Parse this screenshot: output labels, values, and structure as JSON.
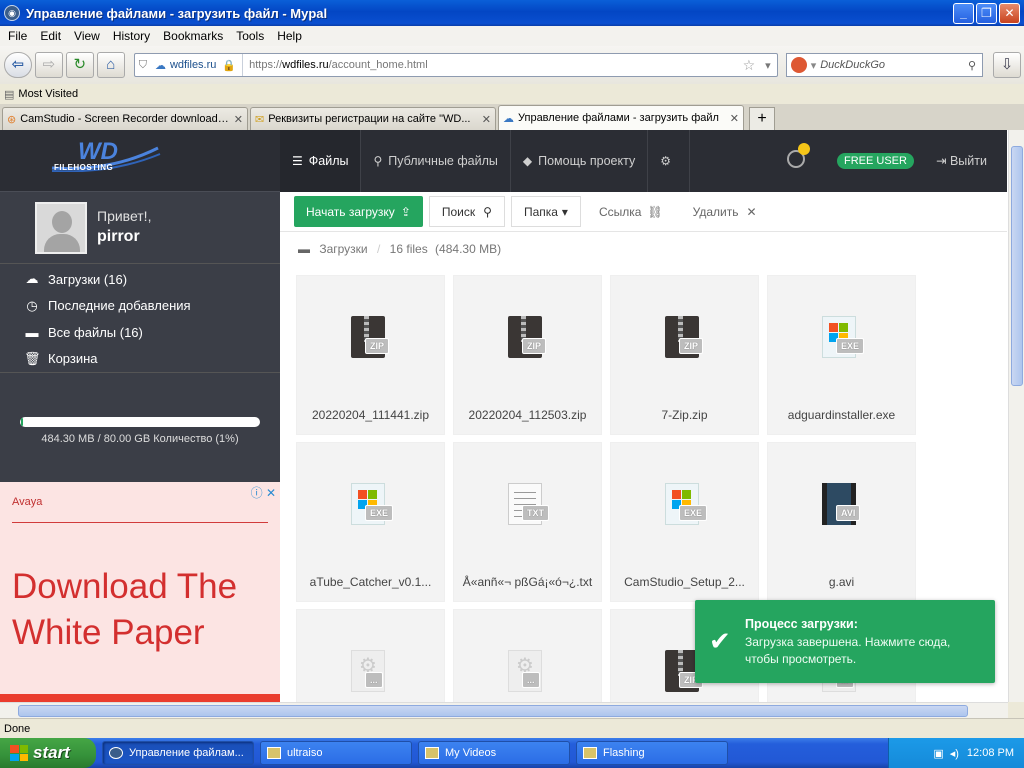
{
  "window": {
    "title": "Управление файлами - загрузить файл - Mypal"
  },
  "menubar": [
    "File",
    "Edit",
    "View",
    "History",
    "Bookmarks",
    "Tools",
    "Help"
  ],
  "navbar": {
    "site_identity": "wdfiles.ru",
    "url_scheme": "https://",
    "url_host": "wdfiles.ru",
    "url_path": "/account_home.html",
    "search_placeholder": "DuckDuckGo"
  },
  "bookmarks": {
    "most_visited": "Most Visited"
  },
  "tabs": [
    {
      "label": "CamStudio - Screen Recorder download |...",
      "active": false
    },
    {
      "label": "Реквизиты регистрации на сайте \"WD...",
      "active": false
    },
    {
      "label": "Управление файлами - загрузить файл",
      "active": true
    }
  ],
  "site": {
    "logo_wd": "WD",
    "logo_sub": "FILEHOSTING",
    "nav": [
      {
        "label": "Файлы",
        "icon": "files-icon",
        "active": true
      },
      {
        "label": "Публичные файлы",
        "icon": "search-icon",
        "active": false
      },
      {
        "label": "Помощь проекту",
        "icon": "tag-icon",
        "active": false
      }
    ],
    "free_user": "FREE USER",
    "logout": "Выйти"
  },
  "sidebar": {
    "greeting": "Привет!,",
    "username": "pirror",
    "menu": [
      {
        "label": "Загрузки (16)",
        "icon": "cloud-upload-icon"
      },
      {
        "label": "Последние добавления",
        "icon": "clock-icon"
      },
      {
        "label": "Все файлы (16)",
        "icon": "stack-icon"
      },
      {
        "label": "Корзина",
        "icon": "trash-icon"
      }
    ],
    "storage_text": "484.30 MB / 80.00 GB Количество (1%)",
    "storage_used_fraction": 0.01
  },
  "ad": {
    "brand": "Avaya",
    "headline": "Download The White Paper"
  },
  "toolbar": {
    "upload": "Начать загрузку",
    "search": "Поиск",
    "folder": "Папка",
    "link": "Ссылка",
    "delete": "Удалить"
  },
  "breadcrumb": {
    "folder": "Загрузки",
    "count": "16 files",
    "size": "(484.30 MB)"
  },
  "files": [
    {
      "name": "20220204_111441.zip",
      "type": "ZIP"
    },
    {
      "name": "20220204_112503.zip",
      "type": "ZIP"
    },
    {
      "name": "7-Zip.zip",
      "type": "ZIP"
    },
    {
      "name": "adguardinstaller.exe",
      "type": "EXE"
    },
    {
      "name": "aTube_Catcher_v0.1...",
      "type": "EXE"
    },
    {
      "name": "Å«anñ«¬ pßGá¡«ó¬¿.txt",
      "type": "TXT"
    },
    {
      "name": "CamStudio_Setup_2...",
      "type": "EXE"
    },
    {
      "name": "g.avi",
      "type": "AVI"
    },
    {
      "name": "",
      "type": "..."
    },
    {
      "name": "",
      "type": "..."
    },
    {
      "name": "",
      "type": "ZIP"
    },
    {
      "name": "",
      "type": "..."
    }
  ],
  "toast": {
    "title": "Процесс загрузки:",
    "message": "Загрузка завершена. Нажмите сюда, чтобы просмотреть."
  },
  "statusbar": {
    "text": "Done"
  },
  "taskbar": {
    "start": "start",
    "tasks": [
      {
        "label": "Управление файлам...",
        "active": true
      },
      {
        "label": "ultraiso",
        "active": false
      },
      {
        "label": "My Videos",
        "active": false
      },
      {
        "label": "Flashing",
        "active": false
      }
    ],
    "clock": "12:08 PM"
  }
}
